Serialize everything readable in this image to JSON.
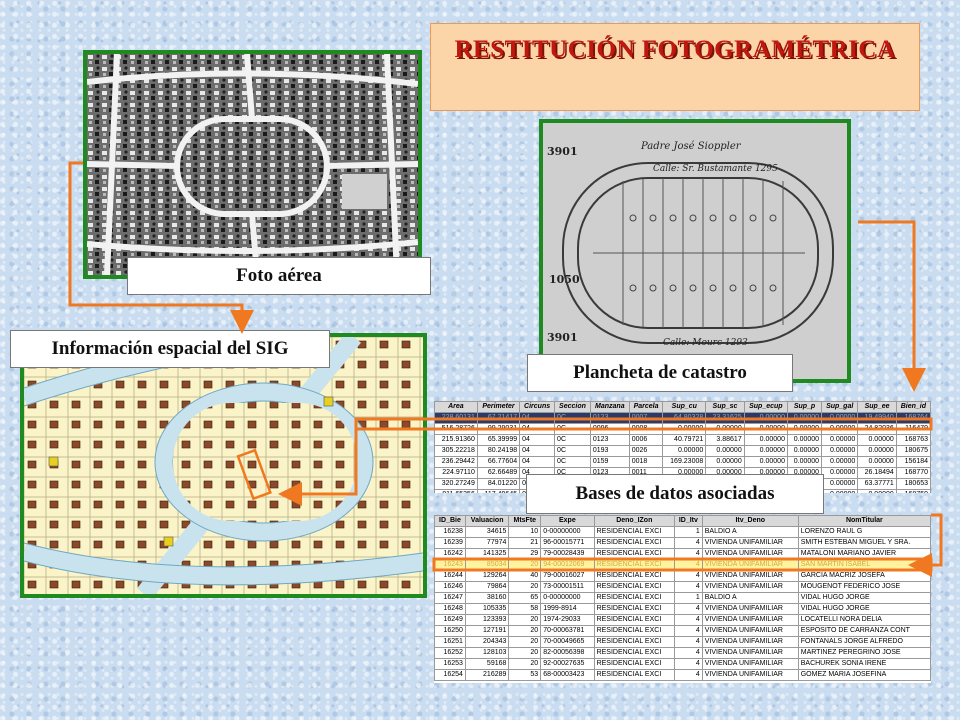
{
  "title": "RESTITUCIÓN FOTOGRAMÉTRICA",
  "captions": {
    "aerial": "Foto aérea",
    "sig": "Información espacial del SIG",
    "cadastre": "Plancheta de catastro",
    "databases": "Bases de datos asociadas"
  },
  "colors": {
    "frame_green": "#1f8a1f",
    "arrow_orange": "#f07820",
    "title_red": "#c0170f",
    "title_bg": "#fbd5a8"
  },
  "cadastre_annotations": {
    "owner": "Padre José Sioppler",
    "street1": "Calle: Sr. Bustamante 1295",
    "street2": "Calle: Mourc 1293",
    "number_a": "3901",
    "number_b": "1050",
    "number_c": "3901"
  },
  "table1": {
    "headers": [
      "Area",
      "Perimeter",
      "Circuns",
      "Seccion",
      "Manzana",
      "Parcela",
      "Sup_cu",
      "Sup_sc",
      "Sup_ecup",
      "Sup_p",
      "Sup_gal",
      "Sup_ee",
      "Bien_id"
    ],
    "rows": [
      [
        "228.60131",
        "67.21417",
        "04",
        "0C",
        "0123",
        "0007",
        "64.80328",
        "23.31625",
        "0.00000",
        "0.00000",
        "0.00000",
        "19.49940",
        "168764"
      ],
      [
        "516.28726",
        "99.29031",
        "04",
        "0C",
        "0096",
        "0008",
        "0.00000",
        "0.00000",
        "0.00000",
        "0.00000",
        "0.00000",
        "24.82036",
        "116479"
      ],
      [
        "215.91360",
        "65.39999",
        "04",
        "0C",
        "0123",
        "0006",
        "40.79721",
        "3.88617",
        "0.00000",
        "0.00000",
        "0.00000",
        "0.00000",
        "168763"
      ],
      [
        "305.22218",
        "80.24198",
        "04",
        "0C",
        "0193",
        "0026",
        "0.00000",
        "0.00000",
        "0.00000",
        "0.00000",
        "0.00000",
        "0.00000",
        "180675"
      ],
      [
        "236.29442",
        "66.77604",
        "04",
        "0C",
        "0159",
        "0018",
        "169.23008",
        "0.00000",
        "0.00000",
        "0.00000",
        "0.00000",
        "0.00000",
        "156184"
      ],
      [
        "224.97110",
        "62.66489",
        "04",
        "0C",
        "0123",
        "0011",
        "0.00000",
        "0.00000",
        "0.00000",
        "0.00000",
        "0.00000",
        "26.18494",
        "168770"
      ],
      [
        "320.27249",
        "84.01220",
        "04",
        "0C",
        "0159",
        "0014",
        "0.00000",
        "0.00000",
        "0.00000",
        "0.00000",
        "0.00000",
        "63.37771",
        "180653"
      ],
      [
        "811.65356",
        "117.49645",
        "04",
        "0C",
        "0123",
        "0002",
        "0.00000",
        "0.00000",
        "0.00000",
        "0.00000",
        "0.00000",
        "0.00000",
        "168759"
      ]
    ]
  },
  "table2": {
    "headers": [
      "ID_Bie",
      "Valuacion",
      "MtsFte",
      "Expe",
      "Deno_IZon",
      "ID_Itv",
      "Itv_Deno",
      "NomTitular"
    ],
    "rows": [
      [
        "16238",
        "34615",
        "10",
        "0-00000000",
        "RESIDENCIAL EXCI",
        "1",
        "BALDIO A",
        "LORENZO RAUL G"
      ],
      [
        "16239",
        "77974",
        "21",
        "96-00015771",
        "RESIDENCIAL EXCI",
        "4",
        "VIVIENDA UNIFAMILIAR",
        "SMITH ESTEBAN MIGUEL Y SRA."
      ],
      [
        "16242",
        "141325",
        "29",
        "79-00028439",
        "RESIDENCIAL EXCI",
        "4",
        "VIVIENDA UNIFAMILIAR",
        "MATALONI MARIANO JAVIER"
      ],
      [
        "16243",
        "85034",
        "20",
        "94-00012069",
        "RESIDENCIAL EXCI",
        "4",
        "VIVIENDA UNIFAMILIAR",
        "SAN MARTIN ISABEL"
      ],
      [
        "16244",
        "129264",
        "40",
        "79-00016027",
        "RESIDENCIAL EXCI",
        "4",
        "VIVIENDA UNIFAMILIAR",
        "GARCIA MACRIZ JOSEFA"
      ],
      [
        "16246",
        "79864",
        "20",
        "73-00001511",
        "RESIDENCIAL EXCI",
        "4",
        "VIVIENDA UNIFAMILIAR",
        "MOUGENOT FEDERICO JOSE"
      ],
      [
        "16247",
        "38160",
        "65",
        "0-00000000",
        "RESIDENCIAL EXCI",
        "1",
        "BALDIO A",
        "VIDAL HUGO JORGE"
      ],
      [
        "16248",
        "105335",
        "58",
        "1999-8914",
        "RESIDENCIAL EXCI",
        "4",
        "VIVIENDA UNIFAMILIAR",
        "VIDAL HUGO JORGE"
      ],
      [
        "16249",
        "123393",
        "20",
        "1974-29033",
        "RESIDENCIAL EXCI",
        "4",
        "VIVIENDA UNIFAMILIAR",
        "LOCATELLI NORA DELIA"
      ],
      [
        "16250",
        "127191",
        "20",
        "70-00063781",
        "RESIDENCIAL EXCI",
        "4",
        "VIVIENDA UNIFAMILIAR",
        "ESPOSITO DE CARRANZA CONT"
      ],
      [
        "16251",
        "204343",
        "20",
        "70-00049665",
        "RESIDENCIAL EXCI",
        "4",
        "VIVIENDA UNIFAMILIAR",
        "FONTANALS JORGE ALFREDO"
      ],
      [
        "16252",
        "128103",
        "20",
        "82-00056398",
        "RESIDENCIAL EXCI",
        "4",
        "VIVIENDA UNIFAMILIAR",
        "MARTINEZ PEREGRINO JOSE"
      ],
      [
        "16253",
        "59168",
        "20",
        "92-00027635",
        "RESIDENCIAL EXCI",
        "4",
        "VIVIENDA UNIFAMILIAR",
        "BACHUREK SONIA IRENE"
      ],
      [
        "16254",
        "216289",
        "53",
        "68-00003423",
        "RESIDENCIAL EXCI",
        "4",
        "VIVIENDA UNIFAMILIAR",
        "GOMEZ MARIA JOSEFINA"
      ]
    ],
    "highlight_row": 3
  }
}
